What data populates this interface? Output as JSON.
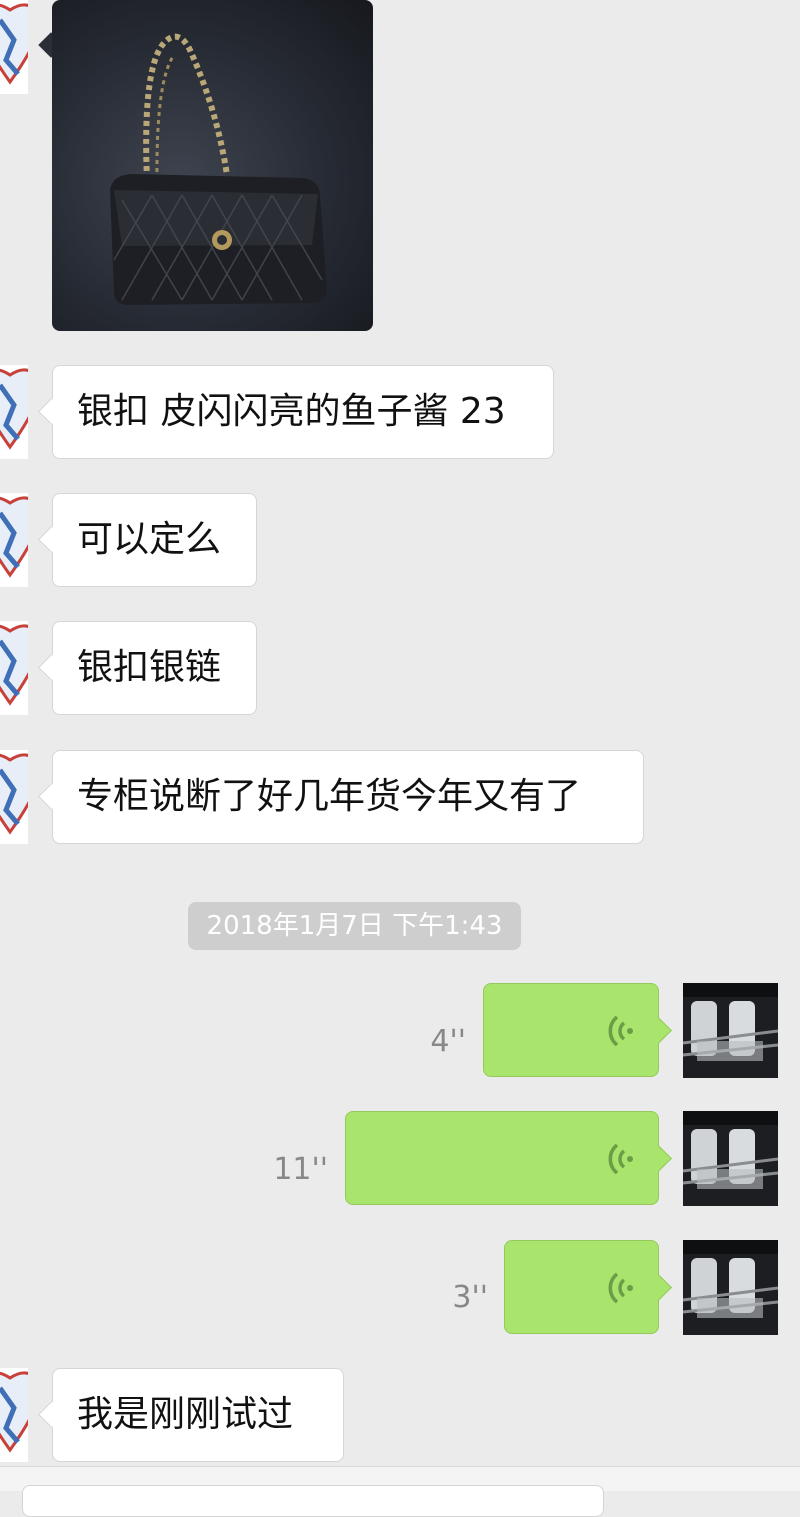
{
  "messages": {
    "m1": "银扣 皮闪闪亮的鱼子酱 23",
    "m2": "可以定么",
    "m3": "银扣银链",
    "m4": "专柜说断了好几年货今年又有了",
    "m5": "我是刚刚试过"
  },
  "timestamp": "2018年1月7日 下午1:43",
  "voice": [
    {
      "duration": "4''"
    },
    {
      "duration": "11''"
    },
    {
      "duration": "3''"
    }
  ],
  "colors": {
    "background": "#ebebeb",
    "incoming_bubble": "#ffffff",
    "outgoing_bubble": "#a9e46c",
    "wave_icon": "#6c9d46",
    "timestamp_bg": "#cecece"
  },
  "icons": {
    "voice": "voice-wave-icon",
    "avatar_left": "heart-avatar",
    "avatar_right": "photo-avatar"
  }
}
